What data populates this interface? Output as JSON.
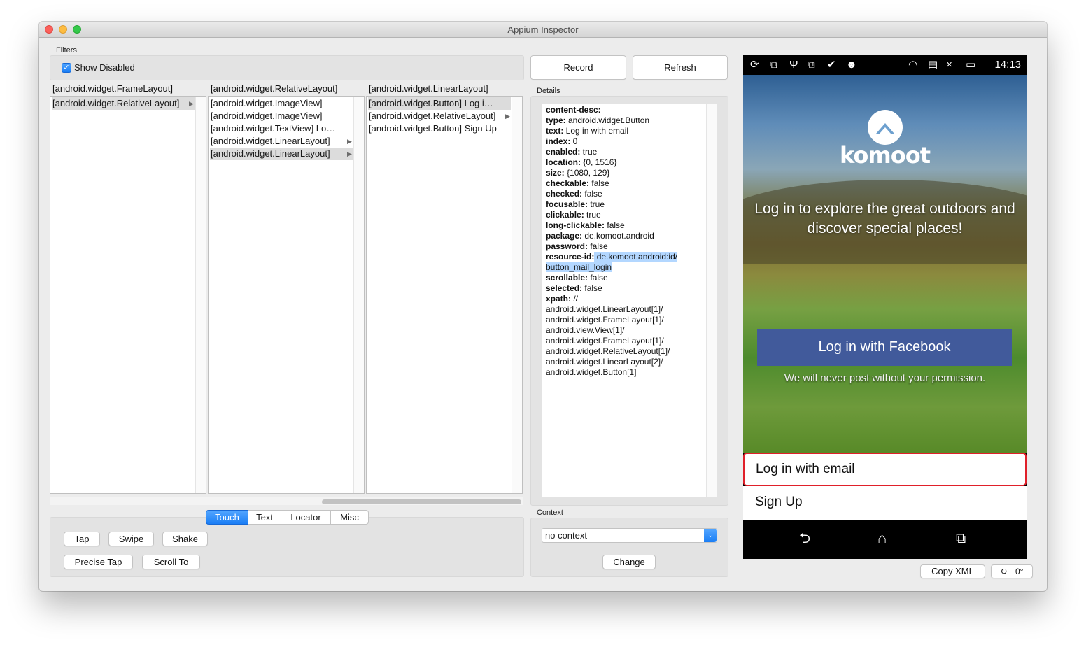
{
  "window": {
    "title": "Appium Inspector"
  },
  "filters": {
    "label": "Filters",
    "show_disabled_label": "Show Disabled",
    "show_disabled_checked": true,
    "check_glyph": "✓"
  },
  "tree": {
    "columns": [
      {
        "header": "[android.widget.FrameLayout]",
        "rows": [
          {
            "label": "[android.widget.RelativeLayout]",
            "selected": true,
            "has_children": true
          }
        ]
      },
      {
        "header": "[android.widget.RelativeLayout]",
        "rows": [
          {
            "label": "[android.widget.ImageView]",
            "selected": false,
            "has_children": false
          },
          {
            "label": "[android.widget.ImageView]",
            "selected": false,
            "has_children": false
          },
          {
            "label": "[android.widget.TextView] Lo…",
            "selected": false,
            "has_children": false
          },
          {
            "label": "[android.widget.LinearLayout]",
            "selected": false,
            "has_children": true
          },
          {
            "label": "[android.widget.LinearLayout]",
            "selected": true,
            "has_children": true
          }
        ]
      },
      {
        "header": "[android.widget.LinearLayout]",
        "rows": [
          {
            "label": "[android.widget.Button] Log i…",
            "selected": true,
            "has_children": false
          },
          {
            "label": "[android.widget.RelativeLayout]",
            "selected": false,
            "has_children": true
          },
          {
            "label": "[android.widget.Button] Sign Up",
            "selected": false,
            "has_children": false
          }
        ]
      }
    ],
    "arrow_glyph": "▶"
  },
  "actions": {
    "tabs": [
      "Touch",
      "Text",
      "Locator",
      "Misc"
    ],
    "active_tab": "Touch",
    "buttons": {
      "tap": "Tap",
      "swipe": "Swipe",
      "shake": "Shake",
      "precise_tap": "Precise Tap",
      "scroll_to": "Scroll To"
    }
  },
  "toolbar": {
    "record_label": "Record",
    "refresh_label": "Refresh"
  },
  "details": {
    "label": "Details",
    "lines": [
      {
        "key": "content-desc:",
        "value": ""
      },
      {
        "key": "type:",
        "value": " android.widget.Button"
      },
      {
        "key": "text:",
        "value": " Log in with email"
      },
      {
        "key": "index:",
        "value": " 0"
      },
      {
        "key": "enabled:",
        "value": " true"
      },
      {
        "key": "location:",
        "value": " {0, 1516}"
      },
      {
        "key": "size:",
        "value": " {1080, 129}"
      },
      {
        "key": "checkable:",
        "value": " false"
      },
      {
        "key": "checked:",
        "value": " false"
      },
      {
        "key": "focusable:",
        "value": " true"
      },
      {
        "key": "clickable:",
        "value": " true"
      },
      {
        "key": "long-clickable:",
        "value": " false"
      },
      {
        "key": "package:",
        "value": " de.komoot.android"
      },
      {
        "key": "password:",
        "value": " false"
      },
      {
        "key": "resource-id:",
        "value": " de.komoot.android:id/",
        "highlight": true
      },
      {
        "key": "",
        "value": "button_mail_login",
        "highlight": true
      },
      {
        "key": "scrollable:",
        "value": " false"
      },
      {
        "key": "selected:",
        "value": " false"
      },
      {
        "key": "xpath:",
        "value": " //"
      },
      {
        "key": "",
        "value": "android.widget.LinearLayout[1]/"
      },
      {
        "key": "",
        "value": "android.widget.FrameLayout[1]/"
      },
      {
        "key": "",
        "value": "android.view.View[1]/"
      },
      {
        "key": "",
        "value": "android.widget.FrameLayout[1]/"
      },
      {
        "key": "",
        "value": "android.widget.RelativeLayout[1]/"
      },
      {
        "key": "",
        "value": "android.widget.LinearLayout[2]/"
      },
      {
        "key": "",
        "value": "android.widget.Button[1]"
      }
    ]
  },
  "context": {
    "label": "Context",
    "selected": "no context",
    "change_label": "Change",
    "dropdown_glyph": "⌄"
  },
  "device": {
    "status_time": "14:13",
    "status_icons": [
      "sync-icon",
      "code-icon",
      "usb-icon",
      "code-icon",
      "clipboard-check-icon",
      "android-icon",
      "wifi-icon",
      "sim-icon",
      "signal-icon",
      "battery-icon"
    ],
    "status_glyphs": [
      "⟳",
      "⧉",
      "Ψ",
      "⧉",
      "✔",
      "☻",
      "◠",
      "▤",
      "✕",
      "▭"
    ],
    "brand": "komoot",
    "tagline": "Log in to explore the great outdoors and discover special places!",
    "facebook_button": "Log in with Facebook",
    "facebook_note": "We will never post without your permission.",
    "email_button": "Log in with email",
    "signup_button": "Sign Up",
    "nav_glyphs": {
      "back": "⮌",
      "home": "⌂",
      "recents": "⧉"
    }
  },
  "footer": {
    "copy_xml_label": "Copy XML",
    "rotation_glyph": "↻",
    "rotation_value": "0°"
  },
  "colors": {
    "accent": "#1b7ef5",
    "highlight": "#e0202a",
    "facebook": "#415a9b"
  }
}
